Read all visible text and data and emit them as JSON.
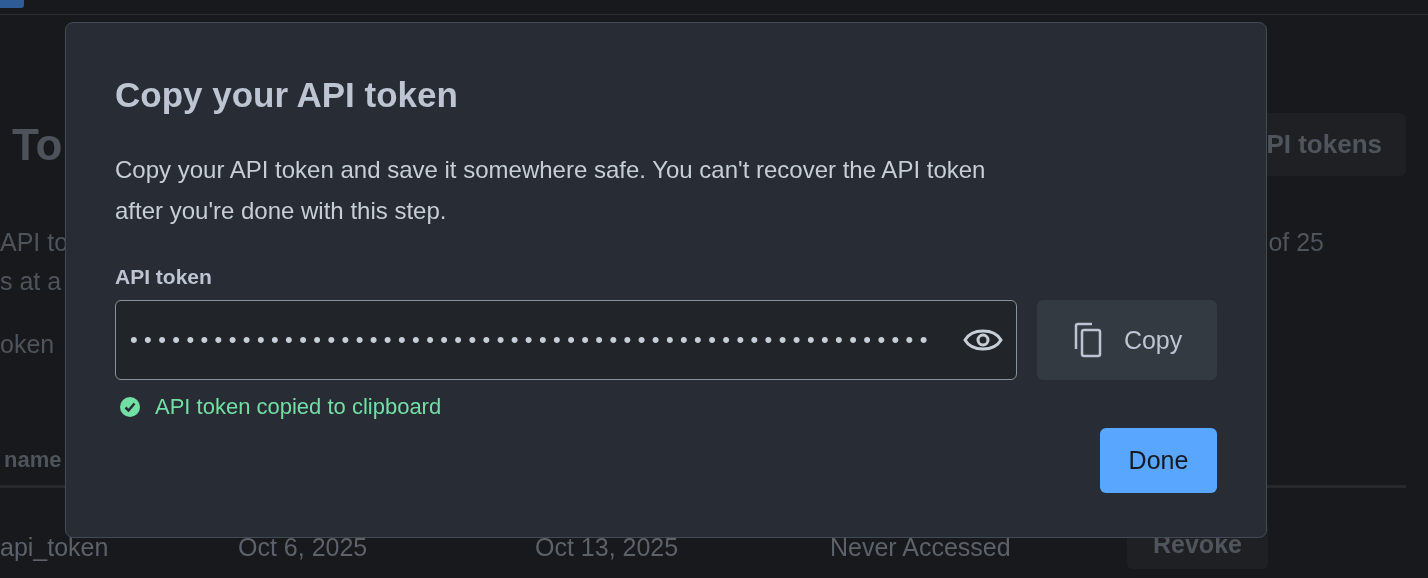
{
  "background_page": {
    "heading": "To",
    "manage_button": "PI tokens",
    "description_lines": [
      "API to",
      "s at a"
    ],
    "limit_text": "of 25",
    "note": "oken",
    "table": {
      "column_header": "name",
      "row": {
        "cells": [
          "api_token",
          "Oct 6, 2025",
          "Oct 13, 2025",
          "Never Accessed"
        ],
        "action": "Revoke"
      }
    }
  },
  "dialog": {
    "title": "Copy your API token",
    "message": "Copy your API token and save it somewhere safe. You can't recover the API token after you're done with this step.",
    "field": {
      "label": "API token",
      "masked_value": "•••••••••••••••••••••••••••••••••••••••••••••••••••••••••"
    },
    "copy_button": "Copy",
    "status": {
      "text": "API token copied to clipboard",
      "success": true
    },
    "done_button": "Done"
  }
}
